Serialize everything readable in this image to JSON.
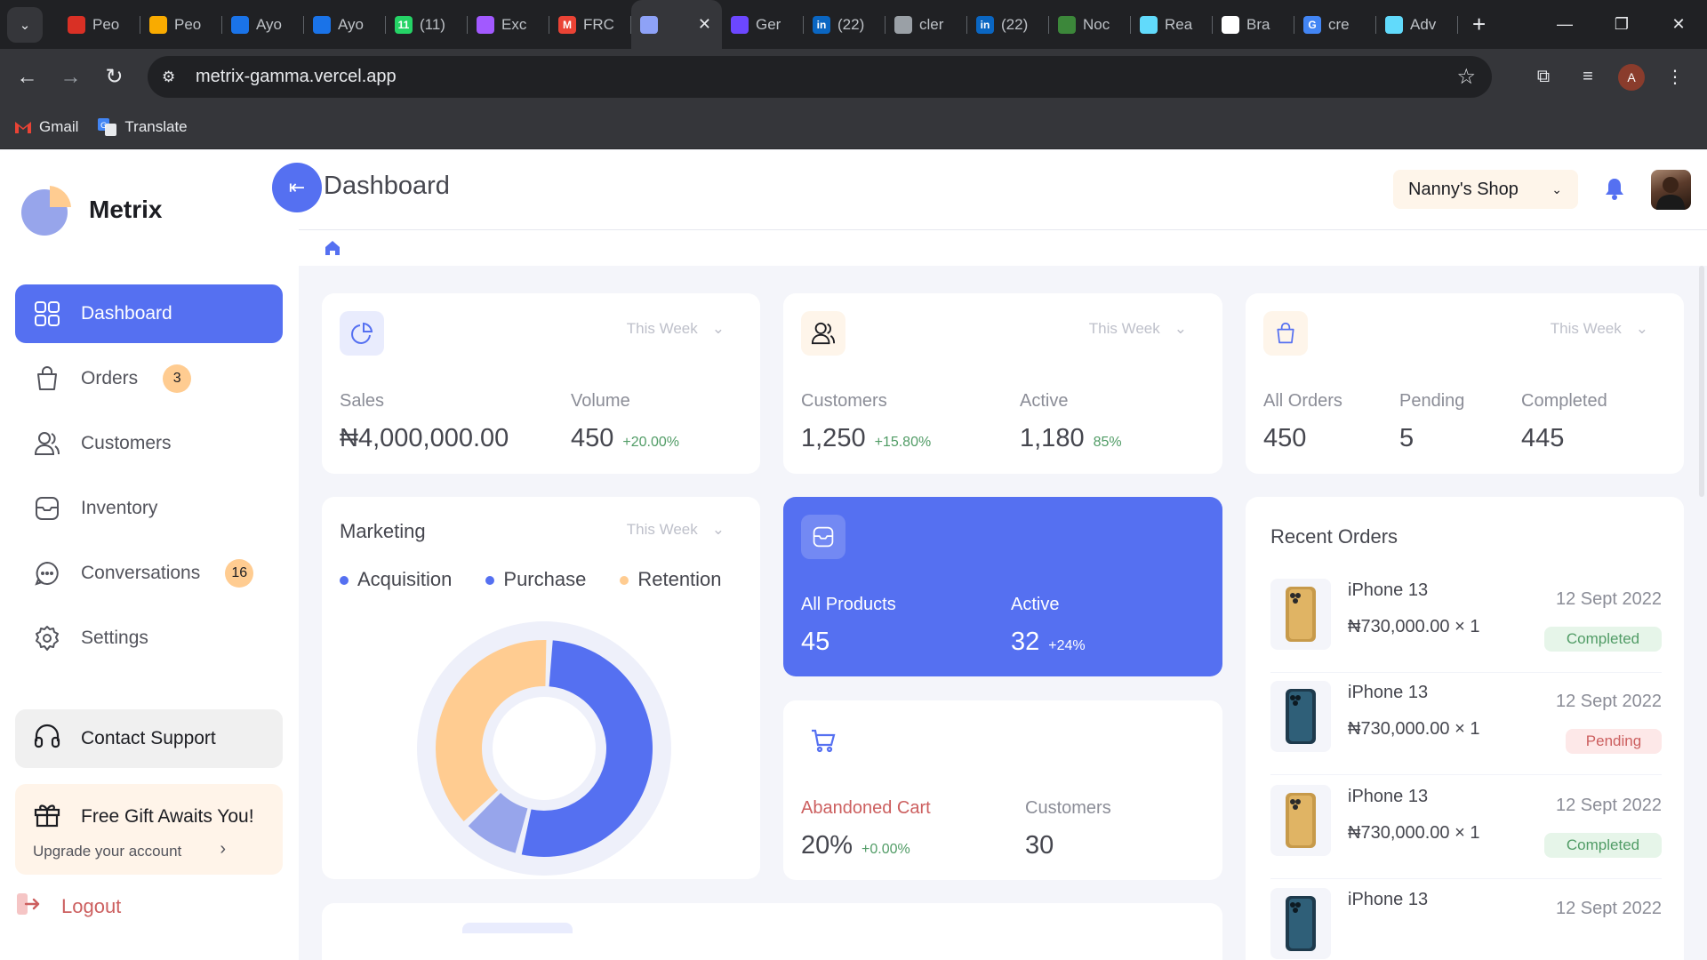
{
  "browser": {
    "tabs": [
      {
        "label": "Peo",
        "fav_color": "#d93025",
        "fav_text": ""
      },
      {
        "label": "Peo",
        "fav_color": "#f9ab00",
        "fav_text": ""
      },
      {
        "label": "Ayo",
        "fav_color": "#1a73e8",
        "fav_text": ""
      },
      {
        "label": "Ayo",
        "fav_color": "#1a73e8",
        "fav_text": ""
      },
      {
        "label": "(11)",
        "fav_color": "#25d366",
        "fav_text": "11"
      },
      {
        "label": "Exc",
        "fav_color": "#a259ff",
        "fav_text": ""
      },
      {
        "label": "FRC",
        "fav_color": "#ea4335",
        "fav_text": "M"
      },
      {
        "label": "",
        "fav_color": "#8ea2f7",
        "fav_text": ""
      },
      {
        "label": "Ger",
        "fav_color": "#6c47ff",
        "fav_text": ""
      },
      {
        "label": "(22)",
        "fav_color": "#0a66c2",
        "fav_text": "in"
      },
      {
        "label": "cler",
        "fav_color": "#9aa0a6",
        "fav_text": ""
      },
      {
        "label": "(22)",
        "fav_color": "#0a66c2",
        "fav_text": "in"
      },
      {
        "label": "Noc",
        "fav_color": "#3c873a",
        "fav_text": ""
      },
      {
        "label": "Rea",
        "fav_color": "#61dafb",
        "fav_text": ""
      },
      {
        "label": "Bra",
        "fav_color": "#ffffff",
        "fav_text": ""
      },
      {
        "label": "cre",
        "fav_color": "#4285f4",
        "fav_text": "G"
      },
      {
        "label": "Adv",
        "fav_color": "#61dafb",
        "fav_text": ""
      }
    ],
    "url": "metrix-gamma.vercel.app",
    "profile_initial": "A",
    "bookmarks": [
      {
        "label": "Gmail"
      },
      {
        "label": "Translate"
      }
    ]
  },
  "sidebar": {
    "brand": "Metrix",
    "items": [
      {
        "label": "Dashboard",
        "icon": "dashboard-icon",
        "badge": ""
      },
      {
        "label": "Orders",
        "icon": "bag-icon",
        "badge": "3"
      },
      {
        "label": "Customers",
        "icon": "users-icon",
        "badge": ""
      },
      {
        "label": "Inventory",
        "icon": "folder-icon",
        "badge": ""
      },
      {
        "label": "Conversations",
        "icon": "chat-icon",
        "badge": "16"
      },
      {
        "label": "Settings",
        "icon": "gear-icon",
        "badge": ""
      }
    ],
    "support": "Contact Support",
    "gift_title": "Free Gift Awaits You!",
    "gift_sub": "Upgrade your account",
    "logout": "Logout"
  },
  "header": {
    "title": "Dashboard",
    "shop": "Nanny's Shop"
  },
  "period_label": "This Week",
  "cards": {
    "sales": {
      "label1": "Sales",
      "value1": "₦4,000,000.00",
      "label2": "Volume",
      "value2": "450",
      "delta2": "+20.00%"
    },
    "customers": {
      "label1": "Customers",
      "value1": "1,250",
      "delta1": "+15.80%",
      "label2": "Active",
      "value2": "1,180",
      "delta2": "85%"
    },
    "orders": {
      "label1": "All Orders",
      "value1": "450",
      "label2": "Pending",
      "value2": "5",
      "label3": "Completed",
      "value3": "445"
    },
    "marketing": {
      "title": "Marketing",
      "legend": [
        "Acquisition",
        "Purchase",
        "Retention"
      ]
    },
    "products": {
      "label1": "All Products",
      "value1": "45",
      "label2": "Active",
      "value2": "32",
      "delta2": "+24%"
    },
    "cart": {
      "label1": "Abandoned Cart",
      "value1": "20%",
      "delta1": "+0.00%",
      "label2": "Customers",
      "value2": "30"
    }
  },
  "chart_data": {
    "type": "pie",
    "categories": [
      "Acquisition",
      "Purchase",
      "Retention"
    ],
    "values": [
      53,
      9,
      38
    ],
    "colors": [
      "#5570f1",
      "#97a5eb",
      "#ffcc91"
    ]
  },
  "recent_orders": {
    "title": "Recent Orders",
    "items": [
      {
        "name": "iPhone 13",
        "price": "₦730,000.00 × 1",
        "date": "12 Sept 2022",
        "status": "Completed",
        "phone": "gold"
      },
      {
        "name": "iPhone 13",
        "price": "₦730,000.00 × 1",
        "date": "12 Sept 2022",
        "status": "Pending",
        "phone": "blue"
      },
      {
        "name": "iPhone 13",
        "price": "₦730,000.00 × 1",
        "date": "12 Sept 2022",
        "status": "Completed",
        "phone": "gold"
      },
      {
        "name": "iPhone 13",
        "price": "",
        "date": "12 Sept 2022",
        "status": "",
        "phone": "blue"
      }
    ]
  }
}
